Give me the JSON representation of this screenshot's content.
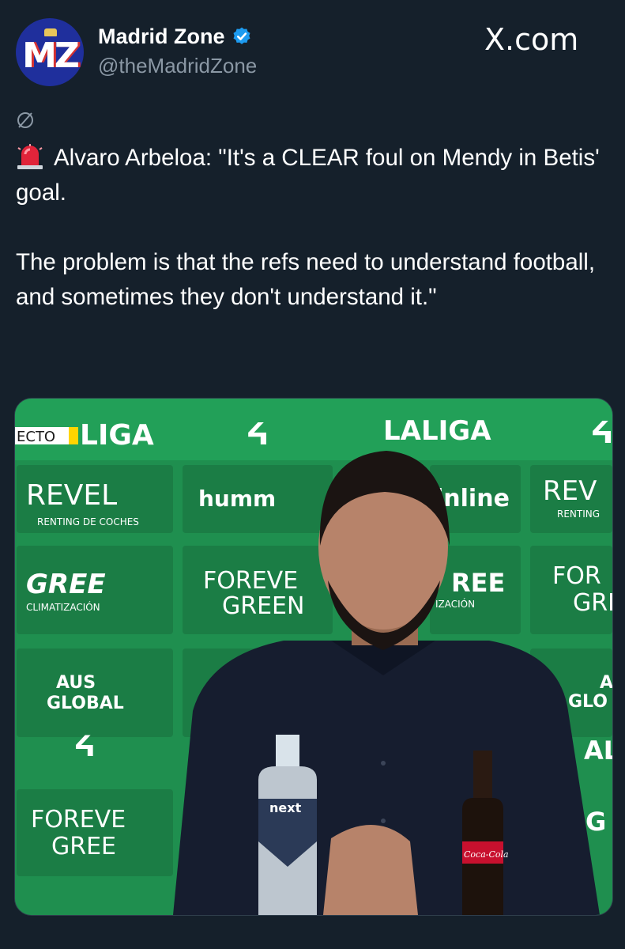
{
  "header": {
    "display_name": "Madrid Zone",
    "handle": "@theMadridZone",
    "site": "X.com",
    "avatar_text": "MZ",
    "verified_icon": "verified-badge-icon",
    "brand_color": "#1d9bf0"
  },
  "tweet": {
    "emoji": "siren-icon",
    "text": "Alvaro Arbeloa: \"It's a CLEAR foul on Mendy in Betis' goal.\n\nThe problem is that the refs need to understand football, and sometimes they don't understand it.\""
  },
  "media": {
    "description_icon": "press-conference-photo",
    "board": {
      "live_tag": "ECTO",
      "laliga_left": "LIGA",
      "laliga_center": "LALIGA",
      "revel": "REVEL",
      "revel_sub": "RENTING DE COCHES",
      "revel_right": "REV",
      "revel_right_sub": "RENTING",
      "hummel": "humm",
      "inline": "inline",
      "gree": "GREE",
      "gree_sub": "CLIMATIZACIÓN",
      "gree_mid": "REE",
      "gree_mid_sub": "IZACIÓN",
      "forever": "FOREVE",
      "green": "GREEN",
      "forever_right": "FOR",
      "green_right": "GRE",
      "aus": "AUS",
      "global": "GLOBAL",
      "aus_right": "A",
      "global_right": "GLO",
      "forever_bottom": "FOREVE",
      "green_bottom": "GREE",
      "al_right": "AL",
      "g_right": "G",
      "water_brand": "next",
      "cola_brand": "Coca-Cola"
    }
  }
}
